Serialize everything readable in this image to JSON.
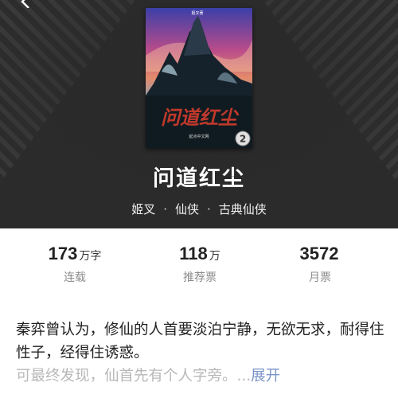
{
  "book": {
    "title": "问道红尘",
    "author": "姬叉",
    "category": "仙侠",
    "subcategory": "古典仙侠",
    "separator": "·",
    "cover": {
      "title_art": "问道红尘",
      "author_tag": "姬叉著",
      "publisher": "起点中文网",
      "badge": "2"
    }
  },
  "stats": [
    {
      "value": "173",
      "unit": "万字",
      "label": "连载"
    },
    {
      "value": "118",
      "unit": "万",
      "label": "推荐票"
    },
    {
      "value": "3572",
      "unit": "",
      "label": "月票"
    }
  ],
  "description": {
    "line1": "秦弈曾认为，修仙的人首要淡泊宁静，无欲无求，耐得住性子，经得住诱惑。",
    "faded": "可最终发现，仙首先有个人字旁。",
    "ellipsis": "...",
    "expand_label": "展开"
  },
  "icons": {
    "back": "back-arrow-icon"
  },
  "colors": {
    "header_bg": "#2b2b2b",
    "expand_link": "#7b95c8"
  }
}
